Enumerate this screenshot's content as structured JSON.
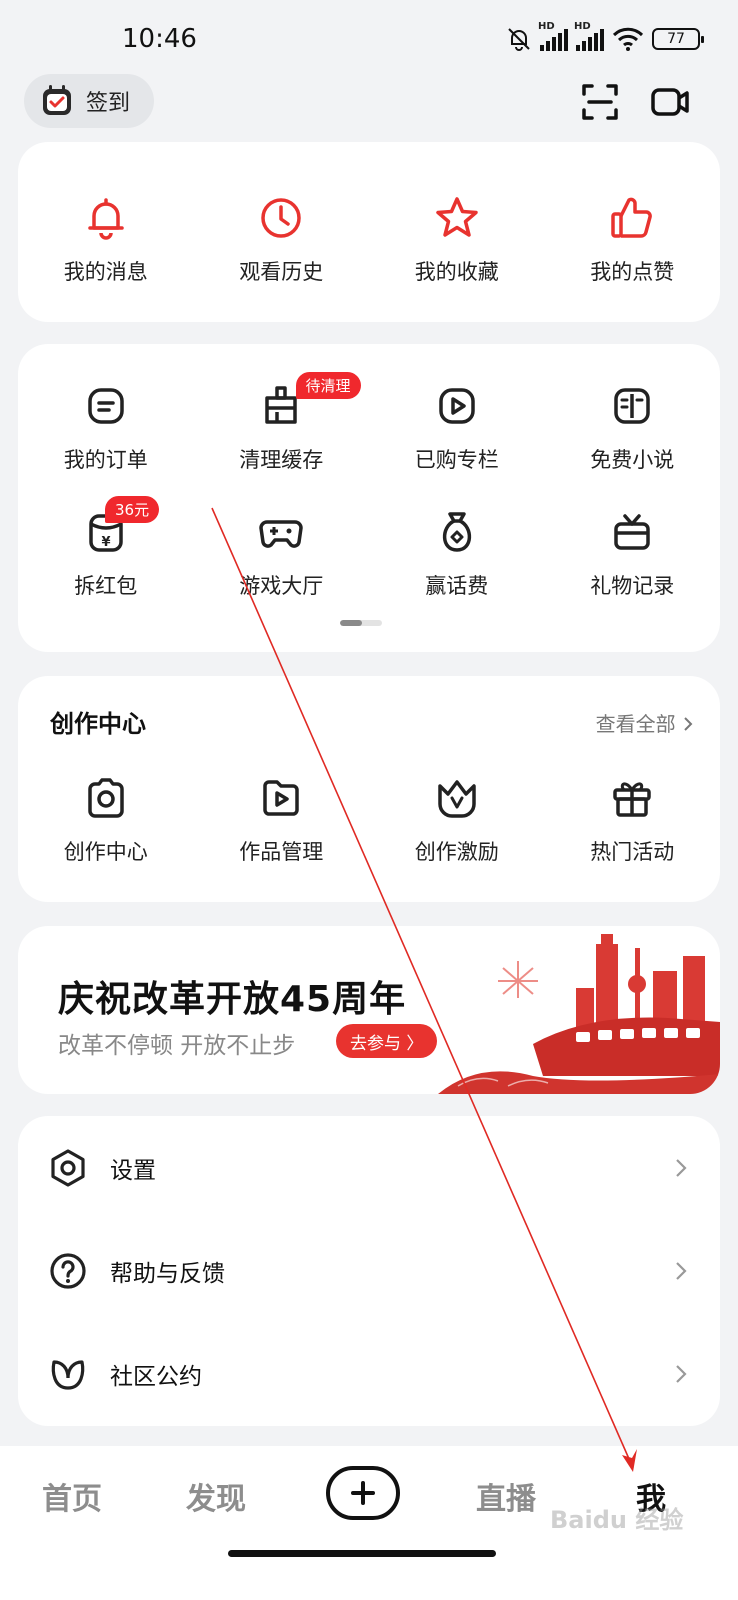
{
  "status": {
    "time": "10:46",
    "hd1": "HD",
    "hd2": "HD",
    "battery": "77"
  },
  "header": {
    "checkin_label": "签到"
  },
  "quick": [
    {
      "label": "我的消息",
      "icon": "bell-icon"
    },
    {
      "label": "观看历史",
      "icon": "clock-icon"
    },
    {
      "label": "我的收藏",
      "icon": "star-icon"
    },
    {
      "label": "我的点赞",
      "icon": "thumbs-up-icon"
    }
  ],
  "services": {
    "row1": [
      {
        "label": "我的订单",
        "icon": "order-icon"
      },
      {
        "label": "清理缓存",
        "icon": "broom-icon",
        "badge": "待清理"
      },
      {
        "label": "已购专栏",
        "icon": "play-square-icon"
      },
      {
        "label": "免费小说",
        "icon": "book-icon"
      }
    ],
    "row2": [
      {
        "label": "拆红包",
        "icon": "red-envelope-icon",
        "badge": "36元"
      },
      {
        "label": "游戏大厅",
        "icon": "gamepad-icon"
      },
      {
        "label": "赢话费",
        "icon": "money-bag-icon"
      },
      {
        "label": "礼物记录",
        "icon": "gift-box-icon"
      }
    ]
  },
  "creation": {
    "title": "创作中心",
    "view_all": "查看全部",
    "items": [
      {
        "label": "创作中心",
        "icon": "camera-icon"
      },
      {
        "label": "作品管理",
        "icon": "video-folder-icon"
      },
      {
        "label": "创作激励",
        "icon": "crown-icon"
      },
      {
        "label": "热门活动",
        "icon": "gift-icon"
      }
    ]
  },
  "banner": {
    "title": "庆祝改革开放45周年",
    "subtitle": "改革不停顿 开放不止步",
    "button": "去参与 〉"
  },
  "menu": [
    {
      "label": "设置",
      "icon": "settings-icon"
    },
    {
      "label": "帮助与反馈",
      "icon": "help-icon"
    },
    {
      "label": "社区公约",
      "icon": "leaf-icon"
    }
  ],
  "nav": {
    "home": "首页",
    "discover": "发现",
    "live": "直播",
    "me": "我"
  },
  "watermark": "Baidu 经验",
  "colors": {
    "accent": "#e8332f",
    "background": "#f2f3f5",
    "badge": "#f0282d"
  }
}
